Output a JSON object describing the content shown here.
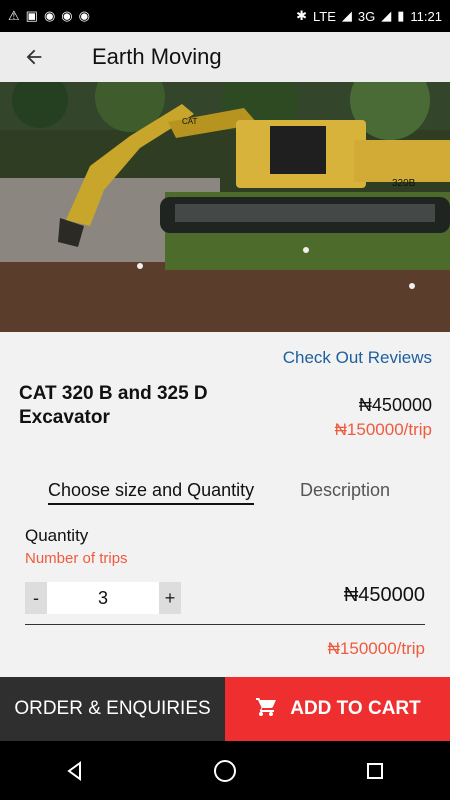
{
  "status": {
    "time": "11:21",
    "network_1": "LTE",
    "network_2": "3G",
    "icons": [
      "warning-icon",
      "image-icon",
      "whatsapp-icon",
      "whatsapp-icon",
      "whatsapp-icon",
      "bluetooth-icon",
      "signal-icon",
      "signal-icon",
      "battery-icon"
    ]
  },
  "header": {
    "title": "Earth Moving"
  },
  "product": {
    "reviews_link": "Check Out Reviews",
    "name": "CAT 320 B and 325 D Excavator",
    "price": "₦450000",
    "price_per_trip": "₦150000/trip",
    "image_text": "320B",
    "image_brand": "CAT"
  },
  "tabs": [
    {
      "label": "Choose size and Quantity"
    },
    {
      "label": "Description"
    }
  ],
  "quantity": {
    "label": "Quantity",
    "sublabel": "Number of trips",
    "minus": "-",
    "value": "3",
    "plus": "+",
    "total": "₦450000",
    "per_trip": "₦150000/trip"
  },
  "actions": {
    "order": "ORDER & ENQUIRIES",
    "cart": "ADD TO CART"
  },
  "colors": {
    "accent_red": "#ef2f2f",
    "accent_orange": "#ef5b3f",
    "link_blue": "#1d5f9f"
  }
}
